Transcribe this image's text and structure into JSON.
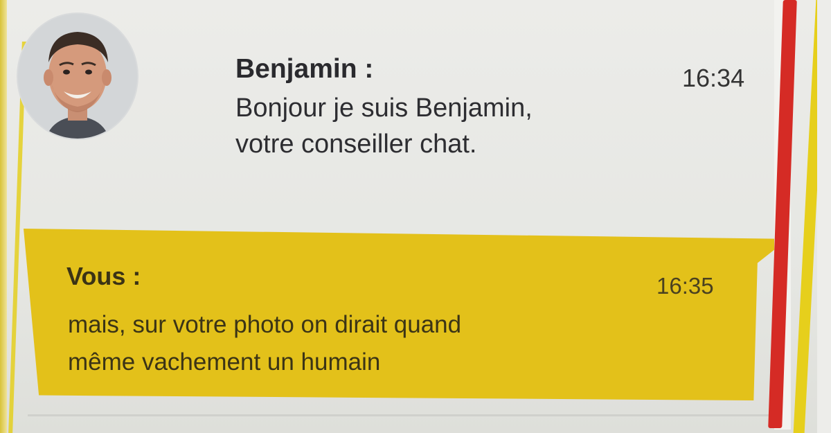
{
  "chat": {
    "agent_message": {
      "sender": "Benjamin :",
      "time": "16:34",
      "text": "Bonjour je suis Benjamin,\nvotre conseiller chat."
    },
    "user_message": {
      "sender": "Vous :",
      "time": "16:35",
      "text": "mais, sur votre photo on dirait quand\nmême vachement un humain"
    }
  },
  "colors": {
    "user_bubble": "#e3c11a",
    "scrollbar_thumb": "#d52b25",
    "frame_accent": "#e6cf1c"
  },
  "icons": {
    "avatar": "agent-avatar-photo"
  }
}
